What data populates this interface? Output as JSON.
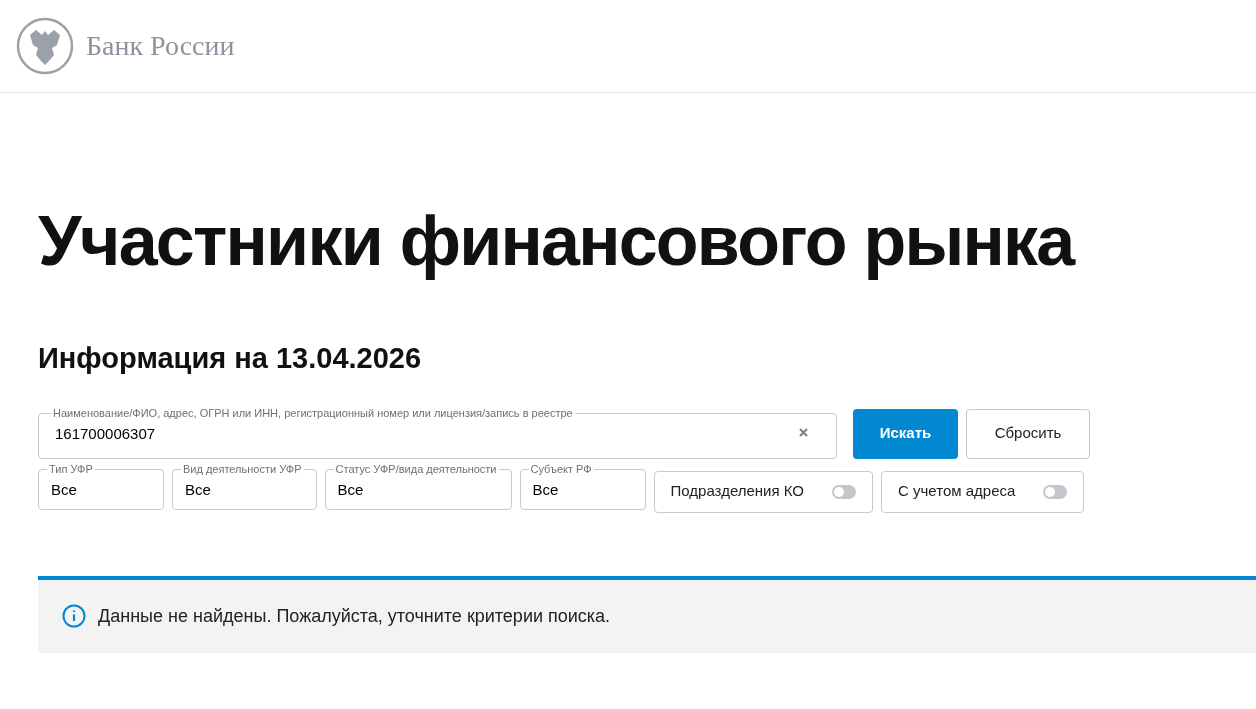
{
  "header": {
    "logo_text": "Банк России"
  },
  "title": "Участники финансового рынка",
  "subtitle": "Информация на 13.04.2026",
  "search": {
    "label": "Наименование/ФИО, адрес, ОГРН или ИНН, регистрационный номер или лицензия/запись в реестре",
    "value": "161700006307"
  },
  "buttons": [
    {
      "label": "Искать",
      "kind": "primary"
    },
    {
      "label": "Сбросить",
      "kind": "secondary"
    }
  ],
  "filters": [
    {
      "kind": "select",
      "label": "Тип УФР",
      "value": "Все"
    },
    {
      "kind": "select",
      "label": "Вид деятельности УФР",
      "value": "Все"
    },
    {
      "kind": "select",
      "label": "Статус УФР/вида деятельности",
      "value": "Все"
    },
    {
      "kind": "select",
      "label": "Субъект РФ",
      "value": "Все"
    },
    {
      "kind": "toggle",
      "label": "Подразделения КО",
      "on": false
    },
    {
      "kind": "toggle",
      "label": "С учетом адреса",
      "on": false
    }
  ],
  "notice": {
    "text": "Данные не найдены. Пожалуйста, уточните критерии поиска."
  }
}
